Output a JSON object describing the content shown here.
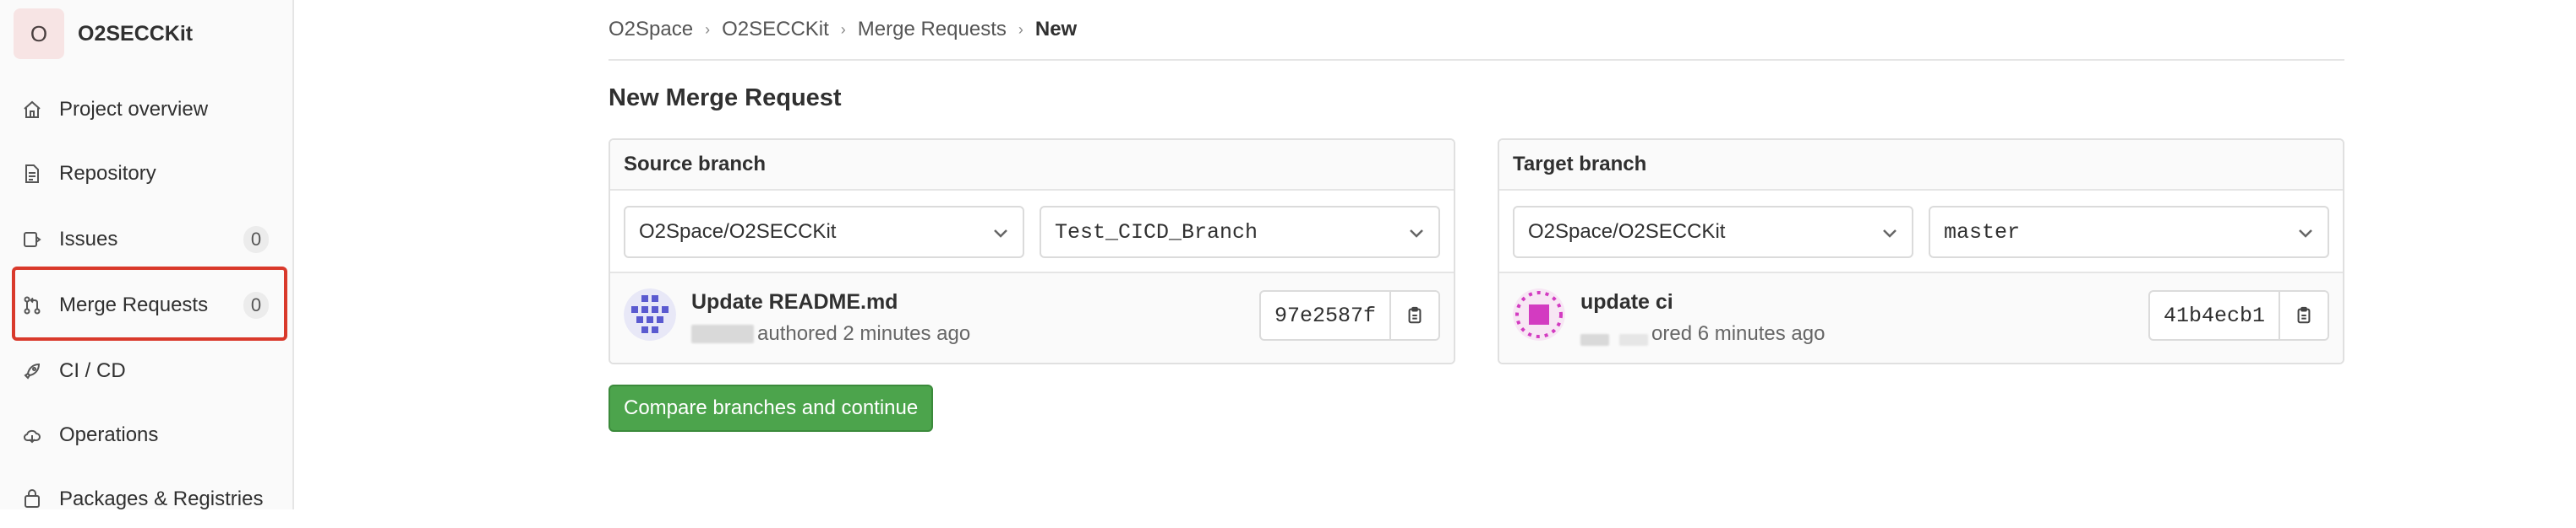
{
  "project": {
    "avatar_letter": "O",
    "name": "O2SECCKit"
  },
  "sidebar": {
    "items": [
      {
        "label": "Project overview",
        "icon": "home-icon"
      },
      {
        "label": "Repository",
        "icon": "document-icon"
      },
      {
        "label": "Issues",
        "icon": "issues-icon",
        "count": "0"
      },
      {
        "label": "Merge Requests",
        "icon": "merge-request-icon",
        "count": "0",
        "highlighted": true
      },
      {
        "label": "CI / CD",
        "icon": "rocket-icon"
      },
      {
        "label": "Operations",
        "icon": "cloud-icon"
      },
      {
        "label": "Packages & Registries",
        "icon": "package-icon"
      }
    ]
  },
  "breadcrumb": [
    "O2Space",
    "O2SECCKit",
    "Merge Requests",
    "New"
  ],
  "page_title": "New Merge Request",
  "source": {
    "title": "Source branch",
    "project": "O2Space/O2SECCKit",
    "branch": "Test_CICD_Branch",
    "commit": {
      "title": "Update README.md",
      "meta": "authored 2 minutes ago",
      "sha": "97e2587f"
    }
  },
  "target": {
    "title": "Target branch",
    "project": "O2Space/O2SECCKit",
    "branch": "master",
    "commit": {
      "title": "update ci",
      "meta": "ored 6 minutes ago",
      "sha": "41b4ecb1"
    }
  },
  "compare_button": "Compare branches and continue",
  "colors": {
    "accent_red": "#d9392b",
    "button_green": "#4ca44c",
    "avatar_bg": "#f7e4e4"
  }
}
